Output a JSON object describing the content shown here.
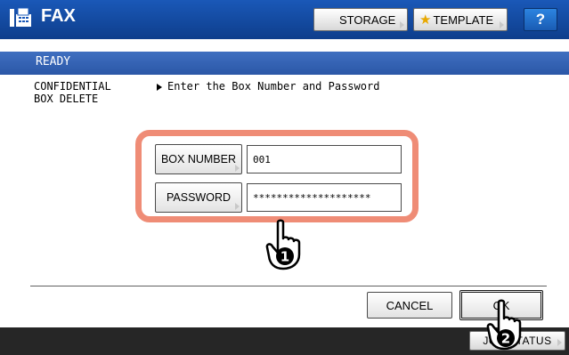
{
  "header": {
    "title": "FAX",
    "storage_label": "STORAGE",
    "template_label": "TEMPLATE",
    "help_label": "?"
  },
  "status": {
    "text": "READY"
  },
  "screen": {
    "function_line1": "CONFIDENTIAL",
    "function_line2": "BOX DELETE",
    "instruction": "Enter the Box Number and Password"
  },
  "form": {
    "box_number_label": "BOX NUMBER",
    "box_number_value": "001",
    "password_label": "PASSWORD",
    "password_value": "********************"
  },
  "actions": {
    "cancel_label": "CANCEL",
    "ok_label": "OK"
  },
  "footer": {
    "job_status_label": "JOB STATUS"
  },
  "callouts": {
    "step1": "1",
    "step2": "2"
  },
  "colors": {
    "header_blue": "#1a58b8",
    "status_blue": "#2b57a7",
    "highlight": "#ef8c76",
    "bottom_bar": "#262626"
  },
  "icons": {
    "fax": "fax-machine-icon",
    "template": "star-icon",
    "hand": "pointing-hand-icon"
  }
}
